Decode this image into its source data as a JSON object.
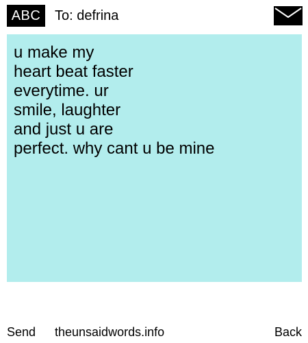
{
  "header": {
    "input_mode": "ABC",
    "recipient_label": "To: defrina",
    "envelope_icon": "envelope-icon"
  },
  "message": {
    "body": "u make my\nheart beat faster\neverytime. ur\nsmile, laughter\nand just u are\nperfect. why cant u be mine",
    "background_color": "#b2eded"
  },
  "footer": {
    "send_label": "Send",
    "site_label": "theunsaidwords.info",
    "back_label": "Back"
  }
}
